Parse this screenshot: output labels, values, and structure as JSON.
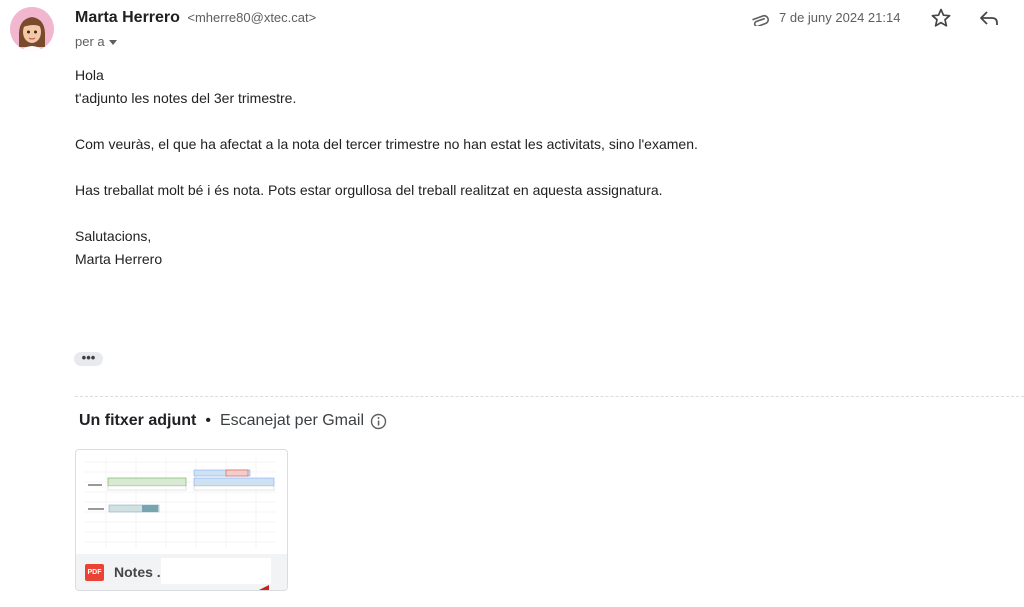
{
  "sender": {
    "name": "Marta Herrero",
    "email": "<mherre80@xtec.cat>"
  },
  "recipient_label": "per a",
  "date": "7 de juny 2024 21:14",
  "icons": {
    "avatar": "memoji-avatar",
    "clip": "paperclip-icon",
    "star": "star-icon",
    "reply": "reply-icon",
    "info": "info-icon",
    "more": "ellipsis-icon"
  },
  "body": {
    "greeting": "Hola",
    "line1": "t'adjunto les notes del 3er trimestre.",
    "line2": "Com veuràs, el que ha afectat a la nota del tercer trimestre no han estat les activitats, sino l'examen.",
    "line3": "Has treballat molt bé i és nota. Pots estar orgullosa del treball realitzat en aquesta assignatura.",
    "closing": "Salutacions,",
    "signature": "Marta Herrero"
  },
  "more_button": "•••",
  "attachments": {
    "count_label": "Un fitxer adjunt",
    "separator": "•",
    "scan_label": "Escanejat per Gmail",
    "file": {
      "type_badge": "PDF",
      "name": "Notes ."
    }
  },
  "colors": {
    "pdf": "#ea4335",
    "avatar_bg": "#f3b6cf"
  }
}
